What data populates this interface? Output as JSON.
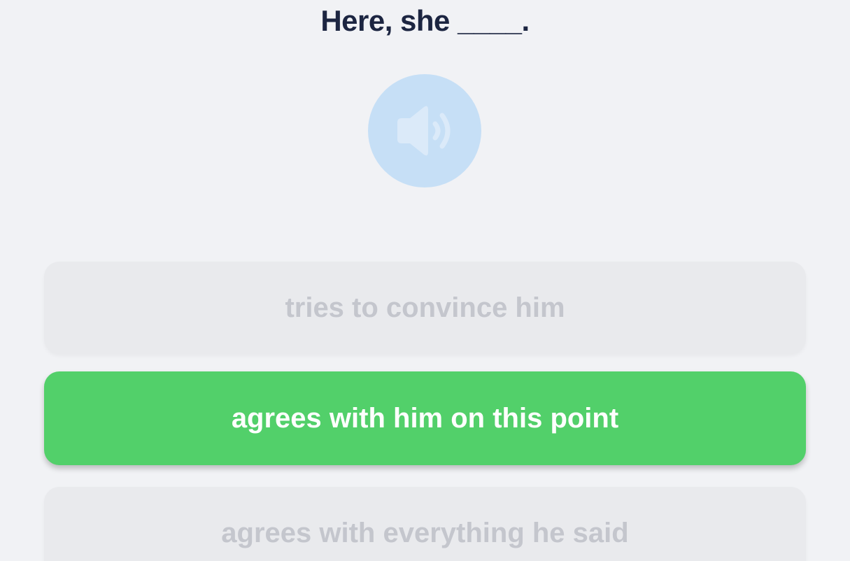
{
  "question": {
    "text": "Here, she ____."
  },
  "audio": {
    "icon": "speaker-icon",
    "button_color": "#c6dff6",
    "icon_color": "#dbeaf9"
  },
  "options": [
    {
      "label": "tries to convince him",
      "state": "disabled"
    },
    {
      "label": "agrees with him on this point",
      "state": "correct"
    },
    {
      "label": "agrees with everything he said",
      "state": "disabled"
    }
  ],
  "colors": {
    "background": "#f1f2f5",
    "title": "#1c2541",
    "correct": "#52d06a",
    "disabled_bg": "#e9eaed",
    "disabled_text": "#c4c6cd"
  }
}
